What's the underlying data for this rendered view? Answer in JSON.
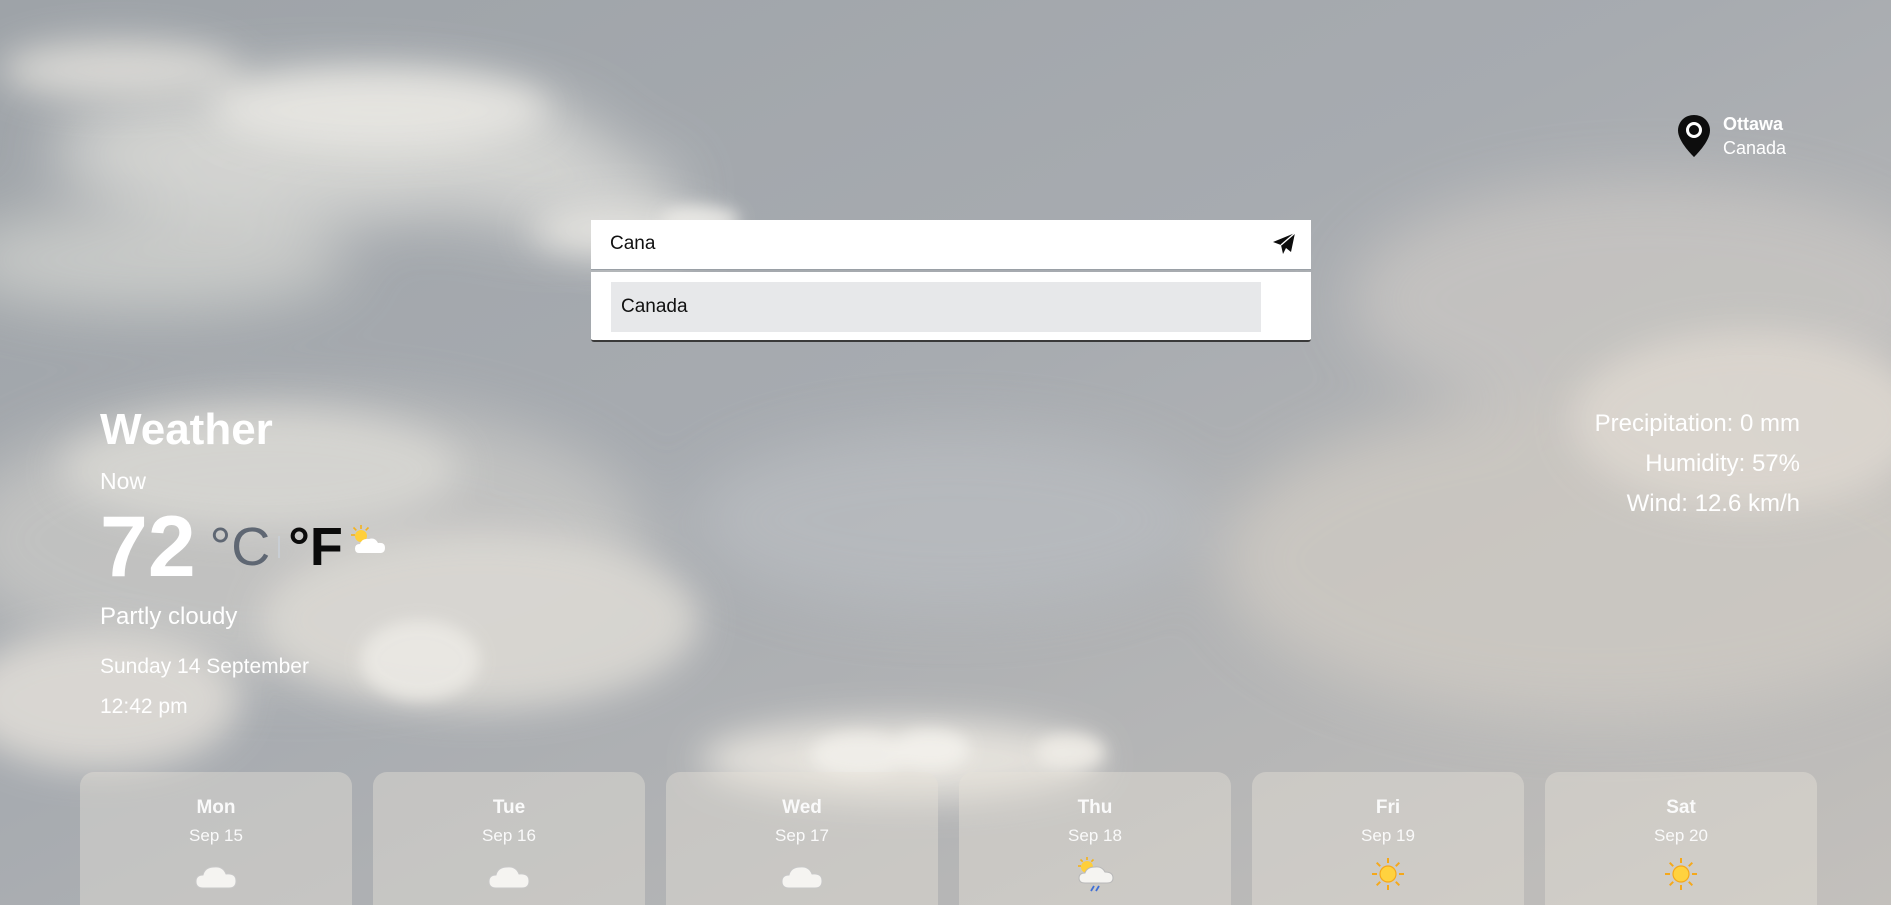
{
  "location": {
    "city": "Ottawa",
    "country": "Canada",
    "icon": "map-pin-icon"
  },
  "search": {
    "value": "Cana",
    "placeholder": "",
    "submit_icon": "paper-plane-icon",
    "suggestions": [
      "Canada"
    ]
  },
  "current": {
    "title": "Weather",
    "now_label": "Now",
    "temperature": "72",
    "unit_c": "°C",
    "unit_f": "°F",
    "active_unit": "F",
    "icon": "partly-cloudy-icon",
    "condition": "Partly cloudy",
    "date": "Sunday 14 September",
    "time": "12:42 pm"
  },
  "stats": {
    "precipitation": "Precipitation: 0 mm",
    "humidity": "Humidity: 57%",
    "wind": "Wind: 12.6 km/h"
  },
  "forecast": [
    {
      "day": "Mon",
      "date": "Sep 15",
      "icon": "cloud-icon"
    },
    {
      "day": "Tue",
      "date": "Sep 16",
      "icon": "cloud-icon"
    },
    {
      "day": "Wed",
      "date": "Sep 17",
      "icon": "cloud-icon"
    },
    {
      "day": "Thu",
      "date": "Sep 18",
      "icon": "sun-cloud-rain-icon"
    },
    {
      "day": "Fri",
      "date": "Sep 19",
      "icon": "sun-icon"
    },
    {
      "day": "Sat",
      "date": "Sep 20",
      "icon": "sun-icon"
    }
  ],
  "colors": {
    "unit_inactive": "#5f6773",
    "unit_active": "#0b0b0b",
    "suggestion_highlight": "#e7e8ea",
    "text": "#ffffff"
  }
}
